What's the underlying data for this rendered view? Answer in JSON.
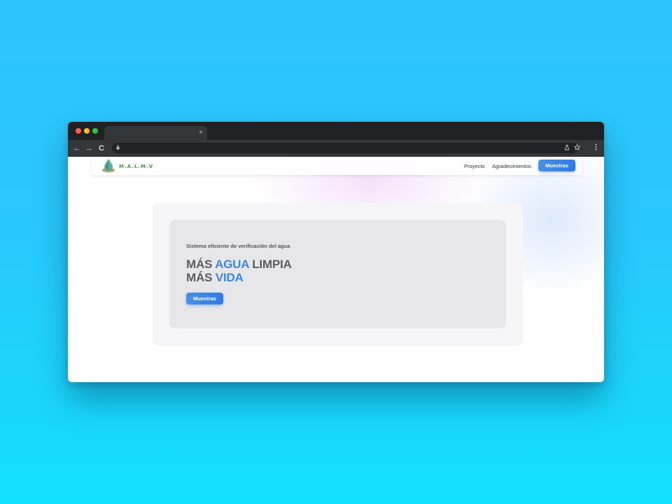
{
  "browser": {
    "tab_close": "×",
    "nav": {
      "back": "←",
      "forward": "→",
      "reload": "C"
    }
  },
  "site": {
    "logo_text": "M.A.L.M.V",
    "nav_links": [
      "Proyecto",
      "Agradecimientos"
    ],
    "nav_button": "Muestras"
  },
  "hero": {
    "subtitle": "Sistema eficiente de verificación del agua",
    "line1_prefix": "MÁS ",
    "line1_accent": "AGUA",
    "line1_suffix": " LIMPIA",
    "line2_prefix": "MÁS ",
    "line2_accent": "VIDA",
    "button": "Muestras"
  },
  "colors": {
    "accent": "#3a86e8",
    "background_top": "#2ec4fb",
    "background_bottom": "#12e0fb"
  }
}
